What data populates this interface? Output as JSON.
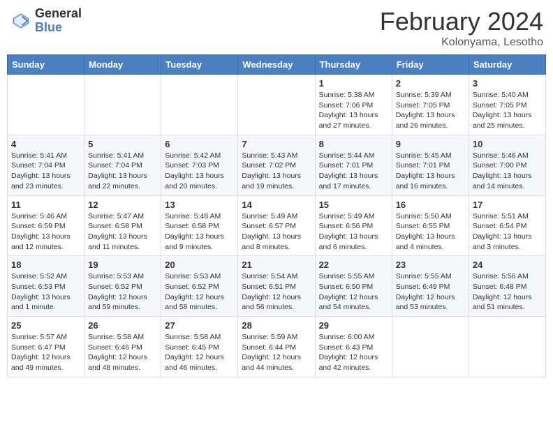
{
  "logo": {
    "general": "General",
    "blue": "Blue"
  },
  "title": "February 2024",
  "subtitle": "Kolonyama, Lesotho",
  "days_of_week": [
    "Sunday",
    "Monday",
    "Tuesday",
    "Wednesday",
    "Thursday",
    "Friday",
    "Saturday"
  ],
  "weeks": [
    [
      {
        "num": "",
        "info": ""
      },
      {
        "num": "",
        "info": ""
      },
      {
        "num": "",
        "info": ""
      },
      {
        "num": "",
        "info": ""
      },
      {
        "num": "1",
        "info": "Sunrise: 5:38 AM\nSunset: 7:06 PM\nDaylight: 13 hours and 27 minutes."
      },
      {
        "num": "2",
        "info": "Sunrise: 5:39 AM\nSunset: 7:05 PM\nDaylight: 13 hours and 26 minutes."
      },
      {
        "num": "3",
        "info": "Sunrise: 5:40 AM\nSunset: 7:05 PM\nDaylight: 13 hours and 25 minutes."
      }
    ],
    [
      {
        "num": "4",
        "info": "Sunrise: 5:41 AM\nSunset: 7:04 PM\nDaylight: 13 hours and 23 minutes."
      },
      {
        "num": "5",
        "info": "Sunrise: 5:41 AM\nSunset: 7:04 PM\nDaylight: 13 hours and 22 minutes."
      },
      {
        "num": "6",
        "info": "Sunrise: 5:42 AM\nSunset: 7:03 PM\nDaylight: 13 hours and 20 minutes."
      },
      {
        "num": "7",
        "info": "Sunrise: 5:43 AM\nSunset: 7:02 PM\nDaylight: 13 hours and 19 minutes."
      },
      {
        "num": "8",
        "info": "Sunrise: 5:44 AM\nSunset: 7:01 PM\nDaylight: 13 hours and 17 minutes."
      },
      {
        "num": "9",
        "info": "Sunrise: 5:45 AM\nSunset: 7:01 PM\nDaylight: 13 hours and 16 minutes."
      },
      {
        "num": "10",
        "info": "Sunrise: 5:46 AM\nSunset: 7:00 PM\nDaylight: 13 hours and 14 minutes."
      }
    ],
    [
      {
        "num": "11",
        "info": "Sunrise: 5:46 AM\nSunset: 6:59 PM\nDaylight: 13 hours and 12 minutes."
      },
      {
        "num": "12",
        "info": "Sunrise: 5:47 AM\nSunset: 6:58 PM\nDaylight: 13 hours and 11 minutes."
      },
      {
        "num": "13",
        "info": "Sunrise: 5:48 AM\nSunset: 6:58 PM\nDaylight: 13 hours and 9 minutes."
      },
      {
        "num": "14",
        "info": "Sunrise: 5:49 AM\nSunset: 6:57 PM\nDaylight: 13 hours and 8 minutes."
      },
      {
        "num": "15",
        "info": "Sunrise: 5:49 AM\nSunset: 6:56 PM\nDaylight: 13 hours and 6 minutes."
      },
      {
        "num": "16",
        "info": "Sunrise: 5:50 AM\nSunset: 6:55 PM\nDaylight: 13 hours and 4 minutes."
      },
      {
        "num": "17",
        "info": "Sunrise: 5:51 AM\nSunset: 6:54 PM\nDaylight: 13 hours and 3 minutes."
      }
    ],
    [
      {
        "num": "18",
        "info": "Sunrise: 5:52 AM\nSunset: 6:53 PM\nDaylight: 13 hours and 1 minute."
      },
      {
        "num": "19",
        "info": "Sunrise: 5:53 AM\nSunset: 6:52 PM\nDaylight: 12 hours and 59 minutes."
      },
      {
        "num": "20",
        "info": "Sunrise: 5:53 AM\nSunset: 6:52 PM\nDaylight: 12 hours and 58 minutes."
      },
      {
        "num": "21",
        "info": "Sunrise: 5:54 AM\nSunset: 6:51 PM\nDaylight: 12 hours and 56 minutes."
      },
      {
        "num": "22",
        "info": "Sunrise: 5:55 AM\nSunset: 6:50 PM\nDaylight: 12 hours and 54 minutes."
      },
      {
        "num": "23",
        "info": "Sunrise: 5:55 AM\nSunset: 6:49 PM\nDaylight: 12 hours and 53 minutes."
      },
      {
        "num": "24",
        "info": "Sunrise: 5:56 AM\nSunset: 6:48 PM\nDaylight: 12 hours and 51 minutes."
      }
    ],
    [
      {
        "num": "25",
        "info": "Sunrise: 5:57 AM\nSunset: 6:47 PM\nDaylight: 12 hours and 49 minutes."
      },
      {
        "num": "26",
        "info": "Sunrise: 5:58 AM\nSunset: 6:46 PM\nDaylight: 12 hours and 48 minutes."
      },
      {
        "num": "27",
        "info": "Sunrise: 5:58 AM\nSunset: 6:45 PM\nDaylight: 12 hours and 46 minutes."
      },
      {
        "num": "28",
        "info": "Sunrise: 5:59 AM\nSunset: 6:44 PM\nDaylight: 12 hours and 44 minutes."
      },
      {
        "num": "29",
        "info": "Sunrise: 6:00 AM\nSunset: 6:43 PM\nDaylight: 12 hours and 42 minutes."
      },
      {
        "num": "",
        "info": ""
      },
      {
        "num": "",
        "info": ""
      }
    ]
  ]
}
